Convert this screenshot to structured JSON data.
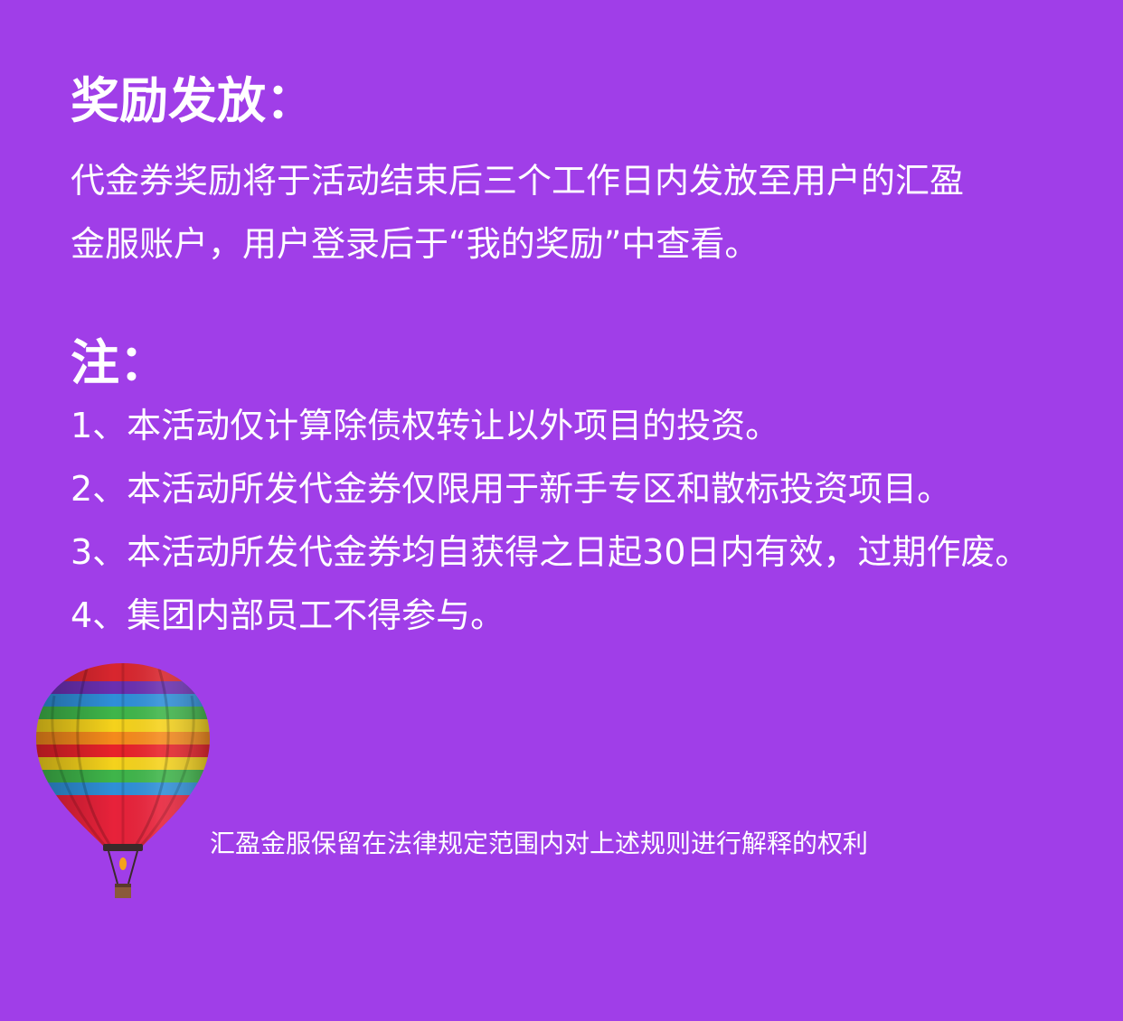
{
  "reward": {
    "title": "奖励发放：",
    "lines": [
      "代金券奖励将于活动结束后三个工作日内发放至用户的汇盈",
      "金服账户，用户登录后于“我的奖励”中查看。"
    ]
  },
  "notes": {
    "title": "注：",
    "items": [
      "1、本活动仅计算除债权转让以外项目的投资。",
      "2、本活动所发代金券仅限用于新手专区和散标投资项目。",
      "3、本活动所发代金券均自获得之日起30日内有效，过期作废。",
      "4、集团内部员工不得参与。"
    ]
  },
  "footer": {
    "note": "汇盈金服保留在法律规定范围内对上述规则进行解释的权利"
  },
  "illustration": {
    "icon": "hot-air-balloon-icon"
  },
  "colors": {
    "background": "#a03ee8",
    "text": "#ffffff"
  }
}
